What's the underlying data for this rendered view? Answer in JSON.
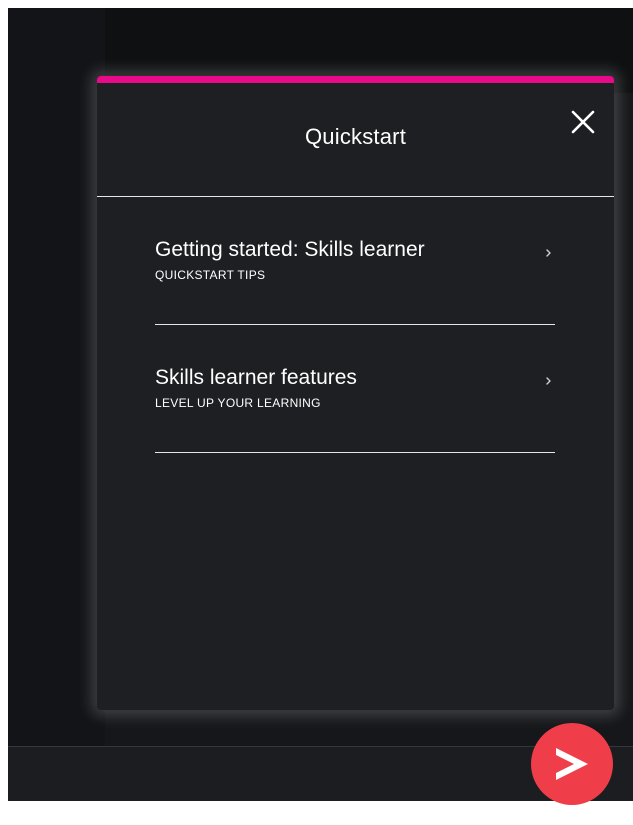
{
  "panel": {
    "title": "Quickstart",
    "close_icon": "close-icon",
    "accent_color": "#e80a89"
  },
  "items": [
    {
      "title": "Getting started: Skills learner",
      "subtitle": "QUICKSTART TIPS",
      "icon": "chevron-right-icon"
    },
    {
      "title": "Skills learner features",
      "subtitle": "LEVEL UP YOUR LEARNING",
      "icon": "chevron-right-icon"
    }
  ],
  "fab": {
    "icon": "play-arrow-icon",
    "color": "#ef3e4a"
  }
}
